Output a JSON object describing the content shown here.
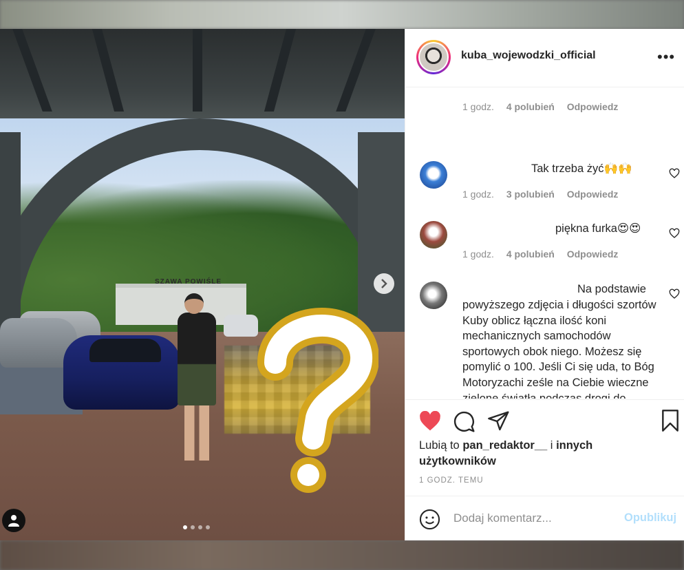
{
  "post": {
    "username": "kuba_wojewodzki_official",
    "more_icon": "more-options-icon",
    "image": {
      "station_sign": "SZAWA POWIŚLE",
      "carousel_dots": 4,
      "active_dot": 1
    }
  },
  "comments": [
    {
      "type": "reply-meta",
      "time": "1 godz.",
      "likes": "4 polubień",
      "reply_label": "Odpowiedz"
    },
    {
      "text": "Tak trzeba żyć🙌🙌",
      "time": "1 godz.",
      "likes": "3 polubień",
      "reply_label": "Odpowiedz"
    },
    {
      "text": "piękna furka😍😍",
      "time": "1 godz.",
      "likes": "4 polubień",
      "reply_label": "Odpowiedz"
    },
    {
      "text_line1": "Na podstawie",
      "text_rest": "powyższego zdjęcia i długości szortów Kuby oblicz łączna ilość koni mechanicznych samochodów sportowych obok niego. Możesz się pomylić o 100. Jeśli Ci się uda, to Bóg Motoryzachi ześle na Ciebie wieczne zielone światła podczas drogi do pracy.."
    }
  ],
  "actions": {
    "liked": true,
    "colors": {
      "heart": "#ed4956",
      "post_disabled": "#b2dffc"
    }
  },
  "likes": {
    "prefix": "Lubią to",
    "user": "pan_redaktor__",
    "connector": "i",
    "others": "innych użytkowników"
  },
  "timestamp": "1 GODZ. TEMU",
  "add_comment": {
    "placeholder": "Dodaj komentarz...",
    "post_label": "Opublikuj"
  }
}
